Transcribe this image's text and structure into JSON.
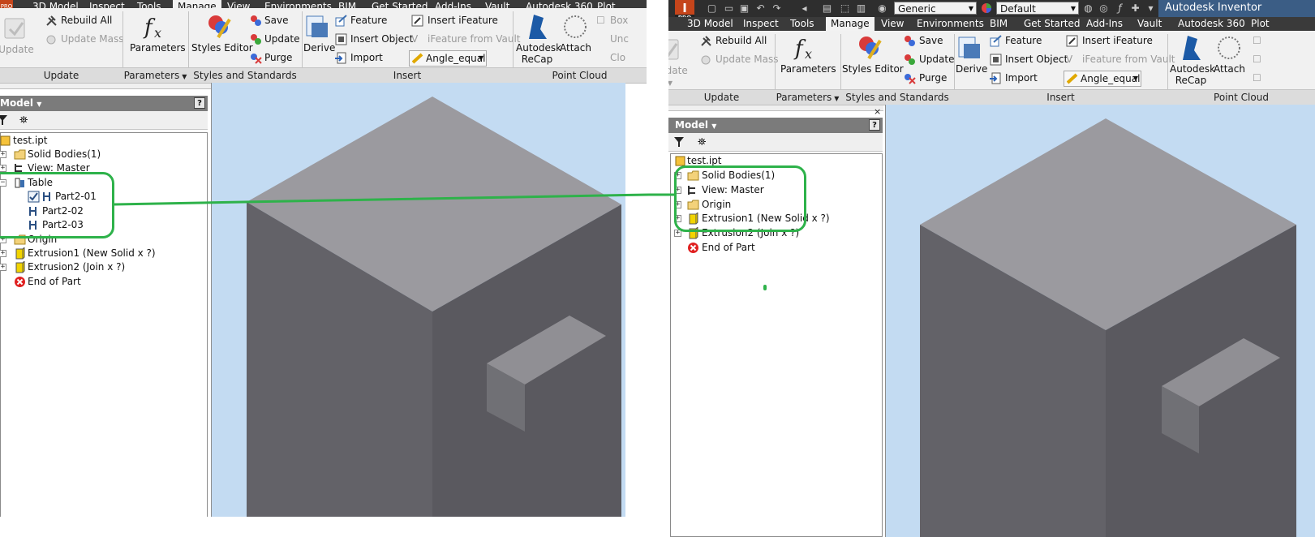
{
  "left": {
    "tabs": [
      "3D Model",
      "Inspect",
      "Tools",
      "Manage",
      "View",
      "Environments",
      "BIM",
      "Get Started",
      "Add-Ins",
      "Vault",
      "Autodesk 360",
      "Plot"
    ],
    "active_tab": "Manage",
    "pro_badge": "PRO",
    "ribbon": {
      "update": {
        "label": "Update",
        "rebuild_all": "Rebuild All",
        "update_mass": "Update Mass",
        "group": "Update"
      },
      "parameters": {
        "label": "Parameters",
        "group": "Parameters"
      },
      "styles": {
        "editor": "Styles Editor",
        "save": "Save",
        "update": "Update",
        "purge": "Purge",
        "group": "Styles and Standards"
      },
      "insert": {
        "derive": "Derive",
        "feature": "Feature",
        "insert_object": "Insert Object",
        "import": "Import",
        "insert_ifeature": "Insert iFeature",
        "ifeature_from_vault": "iFeature from Vault",
        "combo_value": "Angle_equal",
        "group": "Insert"
      },
      "point_cloud": {
        "recap_line1": "Autodesk",
        "recap_line2": "ReCap",
        "attach": "Attach",
        "box": "Box",
        "unc": "Unc",
        "clo": "Clo",
        "group": "Point Cloud"
      }
    },
    "browser": {
      "title": "Model",
      "items": [
        {
          "label": "test.ipt"
        },
        {
          "label": "Solid Bodies(1)"
        },
        {
          "label": "View: Master"
        },
        {
          "label": "Table"
        },
        {
          "label": "Part2-01"
        },
        {
          "label": "Part2-02"
        },
        {
          "label": "Part2-03"
        },
        {
          "label": "Origin"
        },
        {
          "label": "Extrusion1 (New Solid x ?)"
        },
        {
          "label": "Extrusion2 (Join x ?)"
        },
        {
          "label": "End of Part"
        }
      ]
    }
  },
  "right": {
    "tabs": [
      "3D Model",
      "Inspect",
      "Tools",
      "Manage",
      "View",
      "Environments",
      "BIM",
      "Get Started",
      "Add-Ins",
      "Vault",
      "Autodesk 360",
      "Plot"
    ],
    "active_tab": "Manage",
    "pro_badge": "PRO",
    "title_bar": {
      "material": "Generic",
      "appearance": "Default",
      "app_title": "Autodesk Inventor"
    },
    "ribbon": {
      "update": {
        "label": "Update",
        "rebuild_all": "Rebuild All",
        "update_mass": "Update Mass",
        "group": "Update"
      },
      "parameters": {
        "label": "Parameters",
        "group": "Parameters"
      },
      "styles": {
        "editor": "Styles Editor",
        "save": "Save",
        "update": "Update",
        "purge": "Purge",
        "group": "Styles and Standards"
      },
      "insert": {
        "derive": "Derive",
        "feature": "Feature",
        "insert_object": "Insert Object",
        "import": "Import",
        "insert_ifeature": "Insert iFeature",
        "ifeature_from_vault": "iFeature from Vault",
        "combo_value": "Angle_equal",
        "group": "Insert"
      },
      "point_cloud": {
        "recap_line1": "Autodesk",
        "recap_line2": "ReCap",
        "attach": "Attach",
        "group": "Point Cloud"
      }
    },
    "browser": {
      "title": "Model",
      "items": [
        {
          "label": "test.ipt"
        },
        {
          "label": "Solid Bodies(1)"
        },
        {
          "label": "View: Master"
        },
        {
          "label": "Origin"
        },
        {
          "label": "Extrusion1 (New Solid x ?)"
        },
        {
          "label": "Extrusion2 (Join x ?)"
        },
        {
          "label": "End of Part"
        }
      ]
    }
  },
  "colors": {
    "highlight": "#2eb24a",
    "viewport_bg": "#c3dbf2",
    "cube_top": "#9b9a9f",
    "cube_left": "#636268",
    "cube_right": "#5a595f"
  }
}
